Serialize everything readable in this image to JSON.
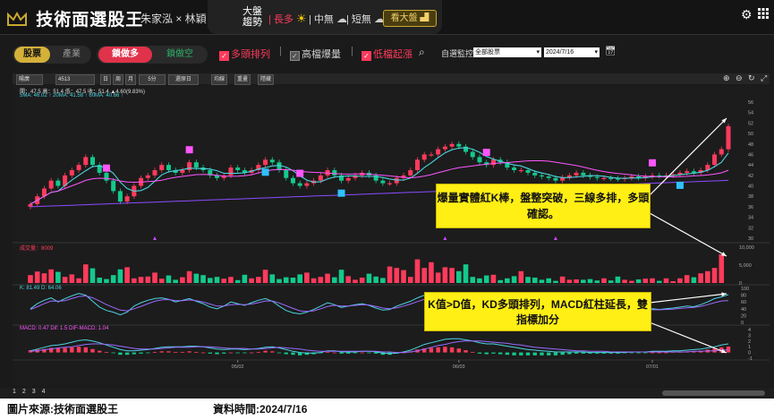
{
  "app": {
    "title": "技術面選股王",
    "authors": "朱家泓 × 林穎"
  },
  "trend": {
    "title": "大盤趨勢",
    "long": "長多",
    "mid": "中無",
    "short": "短無",
    "view_btn": "看大盤"
  },
  "filters": {
    "tab_stock": "股票",
    "tab_industry": "產業",
    "lock_long": "鎖做多",
    "lock_short": "鎖做空",
    "chk_bull": "多頭排列",
    "chk_volume": "高檔爆量",
    "chk_low": "低檔起漲",
    "watch_label": "自選監控",
    "watch_value": "全部股票",
    "date_value": "2024/7/16"
  },
  "toolbar": {
    "stock_name": "陽廣",
    "stock_code": "4513",
    "btn_day": "日",
    "btn_week": "周",
    "btn_month": "月",
    "btn_5min": "5分",
    "btn_adj": "還原日",
    "btn_draw": "均線",
    "btn_clear": "重畫",
    "btn_hide": "隱藏"
  },
  "legends": {
    "price": "開：47.5  高：51.4  低：47.5  收：51.4  ▲4.60(9.83%)",
    "ma": "5MA: 46.02  ↑  20MA: 41.58  ↑  60MA: 40.66  ↑",
    "volume": "成交量：8009",
    "kd": "K: 81.49  D: 64.06",
    "macd": "MACD: 0.47  Dif: 1.5  DIF-MACD: 1.04"
  },
  "notes": {
    "note1": "爆量實體紅K棒，盤整突破，三線多排，多頭確認。",
    "note2": "K值>D值，KD多頭排列，MACD紅柱延長，雙指標加分"
  },
  "pages": [
    "1",
    "2",
    "3",
    "4"
  ],
  "footer": {
    "source": "圖片來源:技術面選股王",
    "time": "資料時間:2024/7/16"
  },
  "colors": {
    "up": "#ff3b5c",
    "down": "#14c98c",
    "ma5": "#4cd3e0",
    "ma20": "#ff55ff",
    "ma60": "#8a4cff",
    "accent": "#c8a830"
  },
  "chart_data": {
    "type": "candlestick",
    "x_ticks": [
      "05/02",
      "06/03",
      "07/01"
    ],
    "price_axis": [
      30,
      32,
      34,
      36,
      38,
      40,
      42,
      44,
      46,
      48,
      50,
      52,
      54,
      56
    ],
    "volume_axis": [
      "10,000",
      "5,000",
      "0"
    ],
    "kd_axis": [
      100,
      80,
      60,
      40,
      20,
      0
    ],
    "macd_axis": [
      4,
      3,
      2,
      1,
      0,
      -1
    ],
    "signals": [
      {
        "type": "B",
        "index": 11
      },
      {
        "type": "B",
        "index": 23
      },
      {
        "type": "B",
        "index": 39
      },
      {
        "type": "B",
        "index": 66
      },
      {
        "type": "B",
        "index": 90
      },
      {
        "type": "S",
        "index": 34
      },
      {
        "type": "S",
        "index": 45
      },
      {
        "type": "S",
        "index": 76
      },
      {
        "type": "S",
        "index": 94
      }
    ],
    "triangle_markers": [
      18,
      60,
      76
    ],
    "closes": [
      36.5,
      38,
      39.5,
      41,
      40,
      42,
      43,
      44,
      45.5,
      44,
      42.5,
      41,
      39,
      37,
      38,
      40,
      41.5,
      42,
      43,
      44,
      43,
      42.5,
      43,
      44.5,
      43.5,
      43,
      42,
      41.5,
      42,
      43.5,
      43,
      42.5,
      43,
      44,
      45,
      44.5,
      43,
      41.5,
      40.5,
      40,
      40.5,
      41,
      42,
      43,
      42,
      41,
      41.5,
      42,
      42.5,
      42,
      41,
      40.5,
      40.5,
      41.5,
      42,
      43,
      45,
      46,
      46,
      47,
      47.5,
      48,
      47.5,
      46.5,
      45.5,
      44.5,
      44,
      45,
      44.5,
      43.5,
      43,
      43,
      42.5,
      42,
      41.8,
      41.5,
      41,
      41.6,
      42,
      42.5,
      42,
      41.7,
      41.5,
      41.5,
      41.4,
      41.3,
      41.5,
      41.8,
      41.5,
      41.8,
      42,
      41.9,
      42,
      42.2,
      42.5,
      42.8,
      42.5,
      43,
      44,
      46,
      47,
      51.4
    ],
    "volume": [
      2200,
      3200,
      2700,
      3800,
      3100,
      1700,
      2400,
      1300,
      5200,
      4100,
      1500,
      1100,
      2200,
      3800,
      4400,
      1300,
      1700,
      1800,
      2900,
      1200,
      2100,
      900,
      1600,
      3300,
      2600,
      2200,
      1400,
      1700,
      1200,
      1700,
      800,
      2300,
      1300,
      1700,
      3700,
      2400,
      1100,
      1600,
      1500,
      2400,
      2900,
      1300,
      1700,
      2600,
      1600,
      3700,
      1900,
      900,
      1500,
      2600,
      1800,
      1400,
      4600,
      4200,
      3600,
      1700,
      6600,
      4200,
      5800,
      2900,
      4400,
      4200,
      3300,
      5200,
      1700,
      1300,
      2100,
      2300,
      800,
      1300,
      1900,
      3300,
      1700,
      1500,
      900,
      1300,
      600,
      1800,
      900,
      1000,
      900,
      1100,
      700,
      1300,
      700,
      1800,
      900,
      600,
      1000,
      1200,
      1300,
      600,
      1300,
      500,
      1300,
      2200,
      1600,
      2700,
      3300,
      4200,
      8009
    ],
    "kd_k": [
      40,
      55,
      65,
      72,
      60,
      70,
      78,
      85,
      80,
      62,
      45,
      35,
      30,
      22,
      30,
      48,
      58,
      65,
      70,
      72,
      68,
      60,
      65,
      70,
      62,
      55,
      45,
      40,
      48,
      60,
      55,
      50,
      58,
      65,
      70,
      62,
      48,
      35,
      28,
      25,
      30,
      38,
      48,
      58,
      52,
      44,
      48,
      52,
      55,
      50,
      42,
      36,
      38,
      48,
      55,
      62,
      72,
      80,
      78,
      82,
      85,
      82,
      72,
      60,
      48,
      40,
      38,
      44,
      40,
      32,
      28,
      30,
      28,
      26,
      25,
      26,
      24,
      32,
      38,
      44,
      40,
      36,
      34,
      34,
      33,
      32,
      35,
      38,
      34,
      38,
      40,
      38,
      40,
      42,
      45,
      48,
      46,
      52,
      60,
      70,
      75,
      81.5
    ],
    "kd_d": [
      38,
      46,
      55,
      63,
      62,
      64,
      70,
      76,
      78,
      72,
      63,
      52,
      44,
      36,
      34,
      40,
      47,
      55,
      62,
      66,
      67,
      64,
      64,
      66,
      64,
      60,
      54,
      48,
      48,
      52,
      53,
      52,
      54,
      58,
      63,
      63,
      57,
      49,
      41,
      34,
      32,
      34,
      40,
      47,
      50,
      48,
      48,
      50,
      52,
      51,
      47,
      42,
      40,
      43,
      48,
      54,
      61,
      68,
      72,
      76,
      80,
      81,
      77,
      70,
      62,
      54,
      48,
      46,
      44,
      40,
      35,
      33,
      31,
      29,
      27,
      26,
      25,
      28,
      32,
      36,
      38,
      37,
      36,
      35,
      34,
      33,
      34,
      35,
      35,
      36,
      37,
      37,
      38,
      39,
      41,
      43,
      44,
      47,
      52,
      58,
      63,
      64.1
    ],
    "macd_bar": [
      0.4,
      0.5,
      0.6,
      0.8,
      0.7,
      0.8,
      0.9,
      1.0,
      0.9,
      0.6,
      0.3,
      0.1,
      -0.1,
      -0.4,
      -0.4,
      -0.3,
      -0.2,
      -0.1,
      0.1,
      0.2,
      0.2,
      0.1,
      0.1,
      0.2,
      0.1,
      0.0,
      -0.2,
      -0.3,
      -0.2,
      0.0,
      -0.1,
      -0.1,
      0.0,
      0.1,
      0.3,
      0.2,
      -0.1,
      -0.3,
      -0.4,
      -0.5,
      -0.4,
      -0.3,
      -0.1,
      0.1,
      0.0,
      -0.2,
      -0.2,
      -0.1,
      0.0,
      -0.1,
      -0.2,
      -0.4,
      -0.4,
      -0.2,
      0.0,
      0.2,
      0.5,
      0.7,
      0.8,
      0.9,
      1.0,
      0.9,
      0.7,
      0.4,
      0.1,
      -0.2,
      -0.3,
      -0.2,
      -0.3,
      -0.4,
      -0.5,
      -0.5,
      -0.5,
      -0.5,
      -0.5,
      -0.5,
      -0.5,
      -0.4,
      -0.3,
      -0.2,
      -0.2,
      -0.2,
      -0.2,
      -0.2,
      -0.2,
      -0.2,
      -0.1,
      -0.1,
      -0.1,
      -0.1,
      0.0,
      0.0,
      0.0,
      0.1,
      0.1,
      0.2,
      0.2,
      0.3,
      0.5,
      0.7,
      0.9,
      1.04
    ],
    "macd_dif": [
      0.3,
      0.6,
      0.9,
      1.2,
      1.3,
      1.5,
      1.8,
      2.1,
      2.2,
      2.0,
      1.7,
      1.3,
      0.9,
      0.5,
      0.3,
      0.3,
      0.4,
      0.5,
      0.7,
      0.9,
      1.0,
      1.0,
      1.0,
      1.1,
      1.1,
      1.0,
      0.8,
      0.6,
      0.5,
      0.6,
      0.6,
      0.5,
      0.6,
      0.7,
      0.9,
      1.0,
      0.8,
      0.5,
      0.2,
      0.0,
      -0.1,
      -0.1,
      0.0,
      0.3,
      0.3,
      0.1,
      0.1,
      0.1,
      0.2,
      0.2,
      0.1,
      -0.1,
      -0.2,
      -0.1,
      0.1,
      0.4,
      0.9,
      1.4,
      1.7,
      2.0,
      2.3,
      2.4,
      2.4,
      2.2,
      2.0,
      1.7,
      1.5,
      1.5,
      1.3,
      1.1,
      0.9,
      0.7,
      0.5,
      0.4,
      0.3,
      0.2,
      0.1,
      0.1,
      0.1,
      0.1,
      0.1,
      0.0,
      0.0,
      0.0,
      0.0,
      0.0,
      0.0,
      0.1,
      0.1,
      0.1,
      0.2,
      0.2,
      0.2,
      0.3,
      0.3,
      0.4,
      0.5,
      0.6,
      0.8,
      1.0,
      1.3,
      1.5
    ],
    "macd_macd": [
      0.2,
      0.3,
      0.5,
      0.6,
      0.8,
      0.9,
      1.0,
      1.2,
      1.4,
      1.5,
      1.5,
      1.4,
      1.3,
      1.1,
      0.9,
      0.7,
      0.6,
      0.6,
      0.6,
      0.7,
      0.8,
      0.9,
      0.9,
      0.9,
      1.0,
      1.0,
      1.0,
      0.9,
      0.8,
      0.7,
      0.7,
      0.7,
      0.6,
      0.6,
      0.7,
      0.8,
      0.9,
      0.8,
      0.7,
      0.6,
      0.4,
      0.3,
      0.2,
      0.2,
      0.2,
      0.2,
      0.2,
      0.2,
      0.2,
      0.2,
      0.2,
      0.1,
      0.1,
      0.0,
      0.0,
      0.1,
      0.3,
      0.6,
      0.9,
      1.2,
      1.4,
      1.7,
      1.9,
      2.0,
      2.0,
      2.0,
      1.9,
      1.8,
      1.7,
      1.6,
      1.4,
      1.3,
      1.1,
      0.9,
      0.8,
      0.7,
      0.6,
      0.5,
      0.4,
      0.3,
      0.3,
      0.2,
      0.2,
      0.2,
      0.1,
      0.1,
      0.1,
      0.1,
      0.1,
      0.1,
      0.1,
      0.1,
      0.1,
      0.1,
      0.1,
      0.1,
      0.2,
      0.2,
      0.3,
      0.3,
      0.4,
      0.47
    ]
  }
}
